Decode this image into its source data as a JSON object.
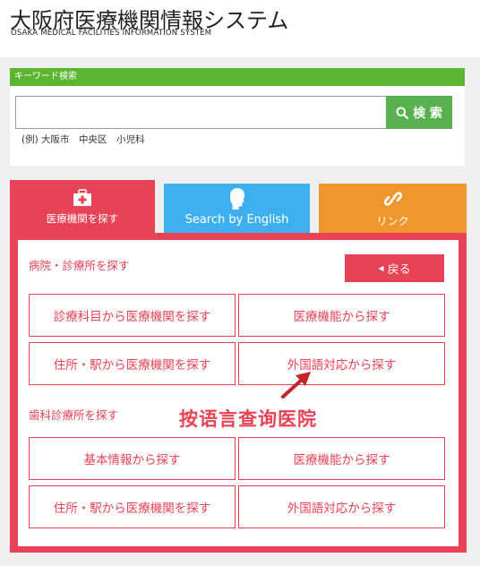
{
  "header": {
    "title": "大阪府医療機関情報システム",
    "subtitle": "OSAKA MEDICAL FACILITIES INFORMATION SYSTEM"
  },
  "search": {
    "heading": "キーワード検索",
    "value": "",
    "placeholder": "",
    "button_label": "検 索",
    "example": "(例) 大阪市　中央区　小児科"
  },
  "tabs": [
    {
      "label": "医療機関を探す",
      "icon": "first-aid-kit-icon",
      "color": "#e84256"
    },
    {
      "label": "Search by English",
      "icon": "person-head-icon",
      "color": "#3fb0ef"
    },
    {
      "label": "リンク",
      "icon": "link-icon",
      "color": "#f0962f"
    }
  ],
  "panel": {
    "back_label": "戻る",
    "hospital_section": {
      "title": "病院・診療所を探す",
      "buttons": [
        "診療科目から医療機関を探す",
        "医療機能から探す",
        "住所・駅から医療機関を探す",
        "外国語対応から探す"
      ]
    },
    "dental_section": {
      "title": "歯科診療所を探す",
      "buttons": [
        "基本情報から探す",
        "医療機能から探す",
        "住所・駅から医療機関を探す",
        "外国語対応から探す"
      ]
    }
  },
  "annotation": {
    "text": "按语言查询医院",
    "color": "#e84256"
  },
  "colors": {
    "accent_red": "#e84256",
    "green": "#5cb52f",
    "blue": "#3fb0ef",
    "orange": "#f0962f"
  }
}
